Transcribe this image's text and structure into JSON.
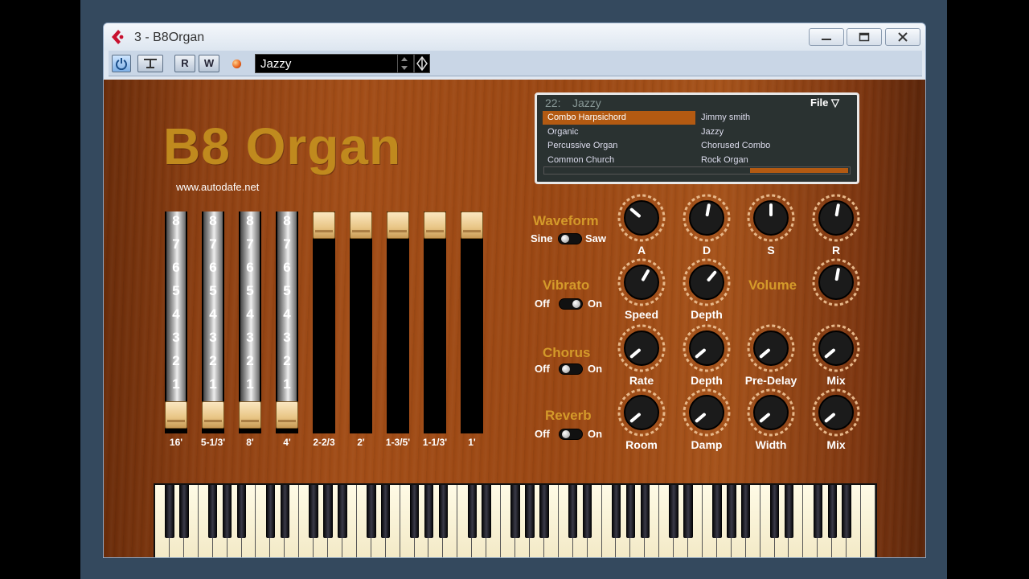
{
  "window": {
    "title": "3 - B8Organ"
  },
  "toolbar": {
    "read_label": "R",
    "write_label": "W",
    "preset": "Jazzy",
    "icons": [
      "power-icon",
      "bypass-icon",
      "record-dot-icon",
      "preset-arrows-icon",
      "preset-menu-icon"
    ]
  },
  "plugin": {
    "brand": "B8 Organ",
    "url": "www.autodafe.net"
  },
  "browser": {
    "number": "22:",
    "title": "Jazzy",
    "file_label": "File ▽",
    "items_left": [
      "Combo Harpsichord",
      "Organic",
      "Percussive Organ",
      "Common Church"
    ],
    "items_right": [
      "Jimmy smith",
      "Jazzy",
      "Chorused Combo",
      "Rock Organ"
    ],
    "selected_index": 0,
    "accent": "#b35a12"
  },
  "drawbars": {
    "numbers": [
      "8",
      "7",
      "6",
      "5",
      "4",
      "3",
      "2",
      "1"
    ],
    "labels": [
      "16'",
      "5-1/3'",
      "8'",
      "4'",
      "2-2/3",
      "2'",
      "1-3/5'",
      "1-1/3'",
      "1'"
    ],
    "levels": [
      8,
      8,
      8,
      8,
      0,
      0,
      0,
      0,
      0
    ]
  },
  "controls": {
    "waveform": {
      "title": "Waveform",
      "left": "Sine",
      "right": "Saw"
    },
    "vibrato": {
      "title": "Vibrato",
      "left": "Off",
      "right": "On"
    },
    "chorus": {
      "title": "Chorus",
      "left": "Off",
      "right": "On"
    },
    "reverb": {
      "title": "Reverb",
      "left": "Off",
      "right": "On"
    },
    "volume_title": "Volume",
    "envelope": [
      "A",
      "D",
      "S",
      "R"
    ],
    "vibrato_knobs": [
      "Speed",
      "Depth"
    ],
    "chorus_knobs": [
      "Rate",
      "Depth",
      "Pre-Delay",
      "Mix"
    ],
    "reverb_knobs": [
      "Room",
      "Damp",
      "Width",
      "Mix"
    ]
  },
  "colors": {
    "brand": "#c08a1e",
    "section_title": "#d49a2a",
    "wood": "#9a4713"
  }
}
